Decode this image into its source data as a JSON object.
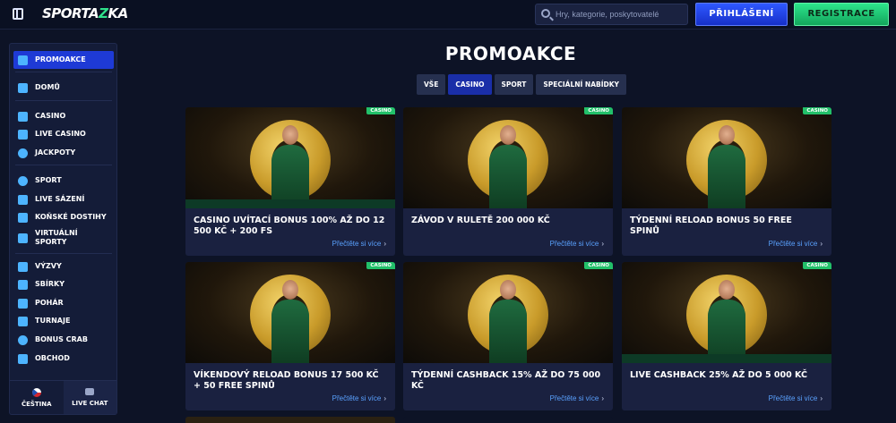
{
  "header": {
    "logo_text_a": "SPORTA",
    "logo_text_b": "KA",
    "search_placeholder": "Hry, kategorie, poskytovatelé",
    "login_label": "PŘIHLÁŠENÍ",
    "register_label": "REGISTRACE"
  },
  "sidebar": {
    "items": [
      {
        "label": "PROMOAKCE",
        "icon": "gift-icon",
        "active": true
      },
      {
        "label": "DOMŮ",
        "icon": "home-icon"
      },
      {
        "label": "CASINO",
        "icon": "slot-machine-icon"
      },
      {
        "label": "LIVE CASINO",
        "icon": "playing-card-icon"
      },
      {
        "label": "JACKPOTY",
        "icon": "clover-icon"
      },
      {
        "label": "SPORT",
        "icon": "soccer-ball-icon"
      },
      {
        "label": "LIVE SÁZENÍ",
        "icon": "live-stats-icon"
      },
      {
        "label": "KOŇSKÉ DOSTIHY",
        "icon": "horse-icon"
      },
      {
        "label": "VIRTUÁLNÍ SPORTY",
        "icon": "virtual-sport-icon"
      },
      {
        "label": "VÝZVY",
        "icon": "challenge-icon"
      },
      {
        "label": "SBÍRKY",
        "icon": "collection-icon"
      },
      {
        "label": "POHÁR",
        "icon": "cup-icon"
      },
      {
        "label": "TURNAJE",
        "icon": "tournament-icon"
      },
      {
        "label": "BONUS CRAB",
        "icon": "crab-icon"
      },
      {
        "label": "OBCHOD",
        "icon": "shop-icon"
      }
    ],
    "footer": {
      "language_label": "ČEŠTINA",
      "chat_label": "LIVE CHAT"
    }
  },
  "main": {
    "title": "PROMOAKCE",
    "tabs": [
      {
        "label": "VŠE"
      },
      {
        "label": "CASINO",
        "active": true
      },
      {
        "label": "SPORT"
      },
      {
        "label": "SPECIÁLNÍ NABÍDKY"
      }
    ],
    "cards": [
      {
        "badge": "CASINO",
        "title": "CASINO UVÍTACÍ BONUS 100% AŽ DO 12 500 KČ + 200 FS",
        "more": "Přečtěte si více"
      },
      {
        "badge": "CASINO",
        "title": "ZÁVOD V RULETĚ 200 000 KČ",
        "more": "Přečtěte si více"
      },
      {
        "badge": "CASINO",
        "title": "TÝDENNÍ RELOAD BONUS 50 FREE SPINŮ",
        "more": "Přečtěte si více"
      },
      {
        "badge": "CASINO",
        "title": "VÍKENDOVÝ RELOAD BONUS 17 500 KČ + 50 FREE SPINŮ",
        "more": "Přečtěte si více"
      },
      {
        "badge": "CASINO",
        "title": "TÝDENNÍ CASHBACK 15% AŽ DO 75 000 KČ",
        "more": "Přečtěte si více"
      },
      {
        "badge": "CASINO",
        "title": "LIVE CASHBACK 25% AŽ DO 5 000 KČ",
        "more": "Přečtěte si více"
      }
    ]
  }
}
